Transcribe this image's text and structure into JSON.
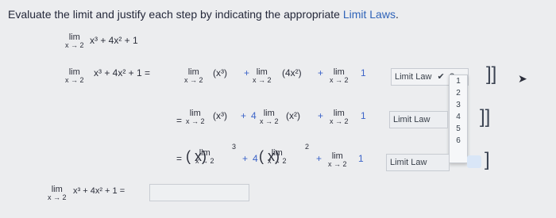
{
  "title": {
    "prefix": "Evaluate the limit and justify each step by indicating the appropriate ",
    "link": "Limit Laws",
    "suffix": "."
  },
  "lim": {
    "word": "lim",
    "sub": "x → 2"
  },
  "problem": {
    "expr": "x³ + 4x² + 1"
  },
  "row1": {
    "lhs": "x³ + 4x² + 1 =",
    "t1": "(x³)",
    "plus1": "+",
    "t2": "(4x²)",
    "plus2": "+",
    "t3": "1",
    "law": "Limit Law",
    "selected": "?"
  },
  "row2": {
    "eq": "=",
    "t1": "(x³)",
    "plus1": "+",
    "coef": "4",
    "t2": "(x²)",
    "plus2": "+",
    "t3": "1",
    "law": "Limit Law"
  },
  "row3": {
    "eq": "=",
    "t1": "(   x)",
    "exp1": "3",
    "plus1": "+",
    "coef": "4",
    "t2": "(   x)",
    "exp2": "2",
    "plus2": "+",
    "t3": "1",
    "law": "Limit Law"
  },
  "dropdown": {
    "options": [
      "1",
      "2",
      "3",
      "4",
      "5",
      "6"
    ]
  },
  "answer": {
    "lhs": "x³ + 4x² + 1 =",
    "value": ""
  }
}
